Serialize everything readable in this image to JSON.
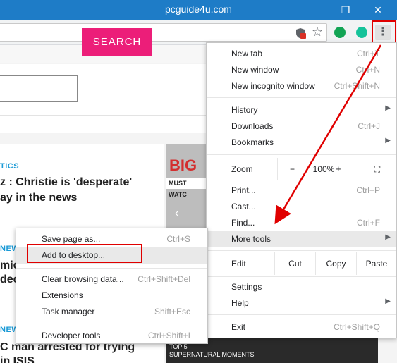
{
  "window": {
    "title": "pcguide4u.com",
    "min_glyph": "—",
    "max_glyph": "❐",
    "close_glyph": "✕"
  },
  "toolbar": {
    "menu_glyph": "⋮",
    "star_glyph": "☆"
  },
  "page": {
    "search_button": "SEARCH",
    "article1": {
      "tag": "TICS",
      "headline_line1": "z : Christie is 'desperate'",
      "headline_line2": "ay in the news"
    },
    "article2": {
      "tag": "NEW",
      "headline_line1": "mic",
      "headline_line2": "dec"
    },
    "article3": {
      "tag": "NEW",
      "headline_line1": "C man arrested for trying",
      "headline_line2": "in ISIS"
    },
    "thumb_big_word": "BIG",
    "thumb_must_watch": "MUST WATC",
    "banner_line1": "TOP 5",
    "banner_line2": "SUPERNATURAL MOMENTS"
  },
  "menu": {
    "new_tab": {
      "label": "New tab",
      "shortcut": "Ctrl+T"
    },
    "new_window": {
      "label": "New window",
      "shortcut": "Ctrl+N"
    },
    "new_incognito": {
      "label": "New incognito window",
      "shortcut": "Ctrl+Shift+N"
    },
    "history": {
      "label": "History"
    },
    "downloads": {
      "label": "Downloads",
      "shortcut": "Ctrl+J"
    },
    "bookmarks": {
      "label": "Bookmarks"
    },
    "zoom": {
      "label": "Zoom",
      "minus": "−",
      "value": "100%",
      "plus": "+",
      "fullscreen_glyph": "⛶"
    },
    "print": {
      "label": "Print...",
      "shortcut": "Ctrl+P"
    },
    "cast": {
      "label": "Cast..."
    },
    "find": {
      "label": "Find...",
      "shortcut": "Ctrl+F"
    },
    "more_tools": {
      "label": "More tools"
    },
    "edit": {
      "label": "Edit",
      "cut": "Cut",
      "copy": "Copy",
      "paste": "Paste"
    },
    "settings": {
      "label": "Settings"
    },
    "help": {
      "label": "Help"
    },
    "exit": {
      "label": "Exit",
      "shortcut": "Ctrl+Shift+Q"
    },
    "submenu_arrow": "▶"
  },
  "submenu": {
    "save_page": {
      "label": "Save page as...",
      "shortcut": "Ctrl+S"
    },
    "add_to_desktop": {
      "label": "Add to desktop..."
    },
    "clear_browsing": {
      "label": "Clear browsing data...",
      "shortcut": "Ctrl+Shift+Del"
    },
    "extensions": {
      "label": "Extensions"
    },
    "task_manager": {
      "label": "Task manager",
      "shortcut": "Shift+Esc"
    },
    "developer_tools": {
      "label": "Developer tools",
      "shortcut": "Ctrl+Shift+I"
    }
  },
  "colors": {
    "titlebar": "#1e7cc7",
    "search_button": "#ec1e79",
    "annotation_red": "#e00000",
    "tag_blue": "#1a9ad6"
  }
}
